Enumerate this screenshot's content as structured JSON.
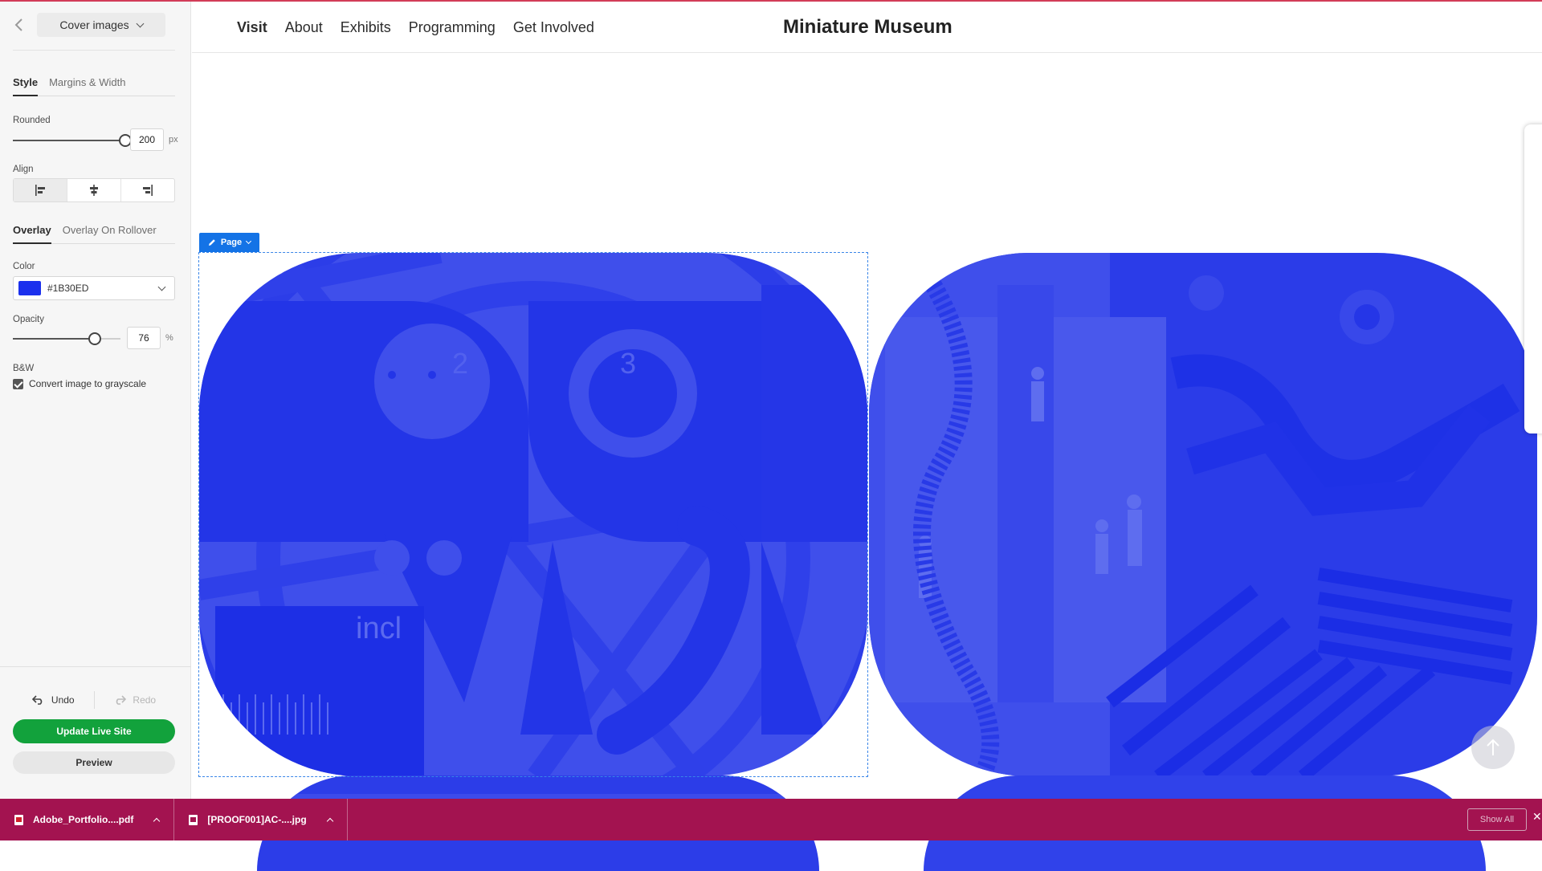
{
  "colors": {
    "accent_top": "#d23c58",
    "overlay": "#1B30ED",
    "update_button": "#12a23c",
    "download_bar": "#a31350",
    "page_tag": "#1473e6"
  },
  "sidebar": {
    "section_dropdown": "Cover images",
    "tabs": [
      "Style",
      "Margins & Width"
    ],
    "rounded": {
      "label": "Rounded",
      "value": "200",
      "unit": "px",
      "level": 1.0
    },
    "align": {
      "label": "Align",
      "options": [
        "align-left-icon",
        "align-center-icon",
        "align-right-icon"
      ],
      "selected": 0
    },
    "overlay_tabs": [
      "Overlay",
      "Overlay On Rollover"
    ],
    "color": {
      "label": "Color",
      "value": "#1B30ED"
    },
    "opacity": {
      "label": "Opacity",
      "value": "76",
      "unit": "%",
      "level": 0.76
    },
    "bw": {
      "label": "B&W",
      "checkbox_label": "Convert image to grayscale",
      "checked": true
    },
    "undo": "Undo",
    "redo": "Redo",
    "update_button": "Update Live Site",
    "preview_button": "Preview"
  },
  "site": {
    "nav": [
      "Visit",
      "About",
      "Exhibits",
      "Programming",
      "Get Involved"
    ],
    "active_nav": "Visit",
    "title": "Miniature Museum"
  },
  "editor": {
    "page_tag": "Page"
  },
  "cover_texts": {
    "artwork_a_digit_1": "2",
    "artwork_a_digit_2": "3",
    "artwork_a_word": "incl"
  },
  "downloads": {
    "items": [
      {
        "name": "Adobe_Portfolio....pdf",
        "icon": "pdf-file-icon"
      },
      {
        "name": "[PROOF001]AC-....jpg",
        "icon": "image-file-icon"
      }
    ],
    "show_all": "Show All"
  }
}
